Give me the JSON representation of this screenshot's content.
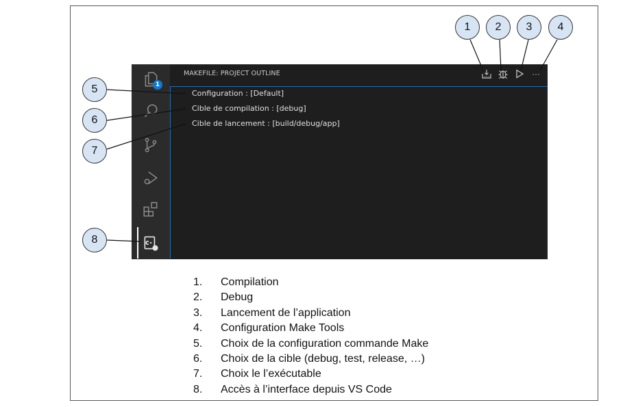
{
  "panel": {
    "title": "MAKEFILE: PROJECT OUTLINE",
    "badge_count": "1",
    "items": [
      {
        "label": "Configuration : [Default]"
      },
      {
        "label": "Cible de compilation : [debug]"
      },
      {
        "label": "Cible de lancement : [build/debug/app]"
      }
    ],
    "toolbar_more": "···"
  },
  "callouts": [
    "1",
    "2",
    "3",
    "4",
    "5",
    "6",
    "7",
    "8"
  ],
  "legend": [
    {
      "num": "1.",
      "text": "Compilation"
    },
    {
      "num": "2.",
      "text": "Debug"
    },
    {
      "num": "3.",
      "text": "Lancement de l’application"
    },
    {
      "num": "4.",
      "text": "Configuration Make Tools"
    },
    {
      "num": "5.",
      "text": "Choix de la configuration commande Make"
    },
    {
      "num": "6.",
      "text": "Choix de la cible (debug, test, release, …)"
    },
    {
      "num": "7.",
      "text": "Choix le l’exécutable"
    },
    {
      "num": "8.",
      "text": "Accès à l’interface depuis VS Code"
    }
  ],
  "colors": {
    "accent": "#0e7ad6",
    "callout_fill": "#d6e4f4",
    "panel_bg": "#1e1e1e",
    "activity_bg": "#2b2b2b"
  }
}
